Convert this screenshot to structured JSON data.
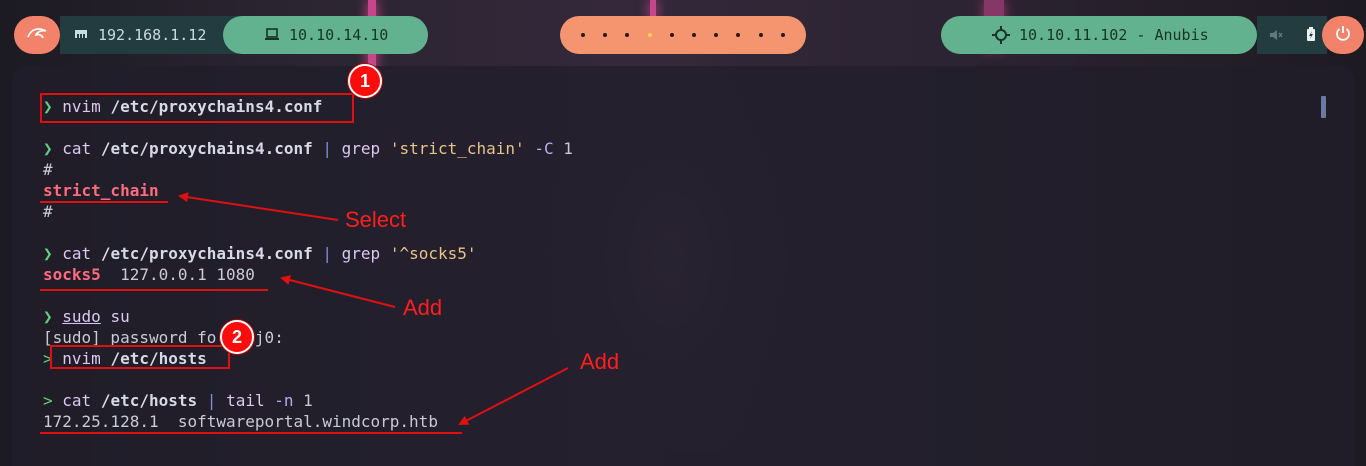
{
  "topbar": {
    "local_ip": "192.168.1.12",
    "vpn_ip": "10.10.14.10",
    "target": "10.10.11.102 - Anubis",
    "workspaces": [
      {
        "active": false
      },
      {
        "active": false
      },
      {
        "active": false
      },
      {
        "active": true
      },
      {
        "active": false
      },
      {
        "active": false
      },
      {
        "active": false
      },
      {
        "active": false
      },
      {
        "active": false
      },
      {
        "active": false
      }
    ],
    "icons": {
      "launcher": "kali-dragon-icon",
      "local": "ethernet-icon",
      "vpn": "laptop-icon",
      "target": "crosshair-icon",
      "sound": "volume-muted-icon",
      "battery": "battery-charging-icon",
      "power": "power-icon"
    },
    "colors": {
      "accent_orange": "#f3826a",
      "accent_green": "#63b28f",
      "dark": "#233c3f"
    }
  },
  "terminal": {
    "prompt_symbol": "❯",
    "root_prompt_symbol": ">",
    "line1": {
      "cmd": "nvim",
      "args": " /etc/proxychains4.conf"
    },
    "line2": {
      "cmd": "cat",
      "path": " /etc/proxychains4.conf",
      "pipe": " | ",
      "grep": "grep",
      "pattern": " 'strict_chain'",
      "flag": " -C",
      "num": " 1"
    },
    "out_hash1": "#",
    "out_strict": "strict_chain",
    "out_hash2": "#",
    "line3": {
      "cmd": "cat",
      "path": " /etc/proxychains4.conf",
      "pipe": " | ",
      "grep": "grep",
      "pattern": " '^socks5'"
    },
    "out_socks_kw": "socks5",
    "out_socks_rest": "  127.0.0.1 1080",
    "line4": {
      "cmd": "sudo",
      "arg": " su"
    },
    "out_sudo_pw": "[sudo] password fo  l3j0:",
    "line5": {
      "cmd": "nvim",
      "args": " /etc/hosts"
    },
    "line6": {
      "cmd": "cat",
      "path": " /etc/hosts",
      "pipe": " | ",
      "tail": "tail",
      "flag": " -n",
      "num": " 1"
    },
    "out_hosts": "172.25.128.1  softwareportal.windcorp.htb"
  },
  "annotations": {
    "badge1": "1",
    "badge2": "2",
    "label_select": "Select",
    "label_add1": "Add",
    "label_add2": "Add",
    "color": "#e01010"
  }
}
